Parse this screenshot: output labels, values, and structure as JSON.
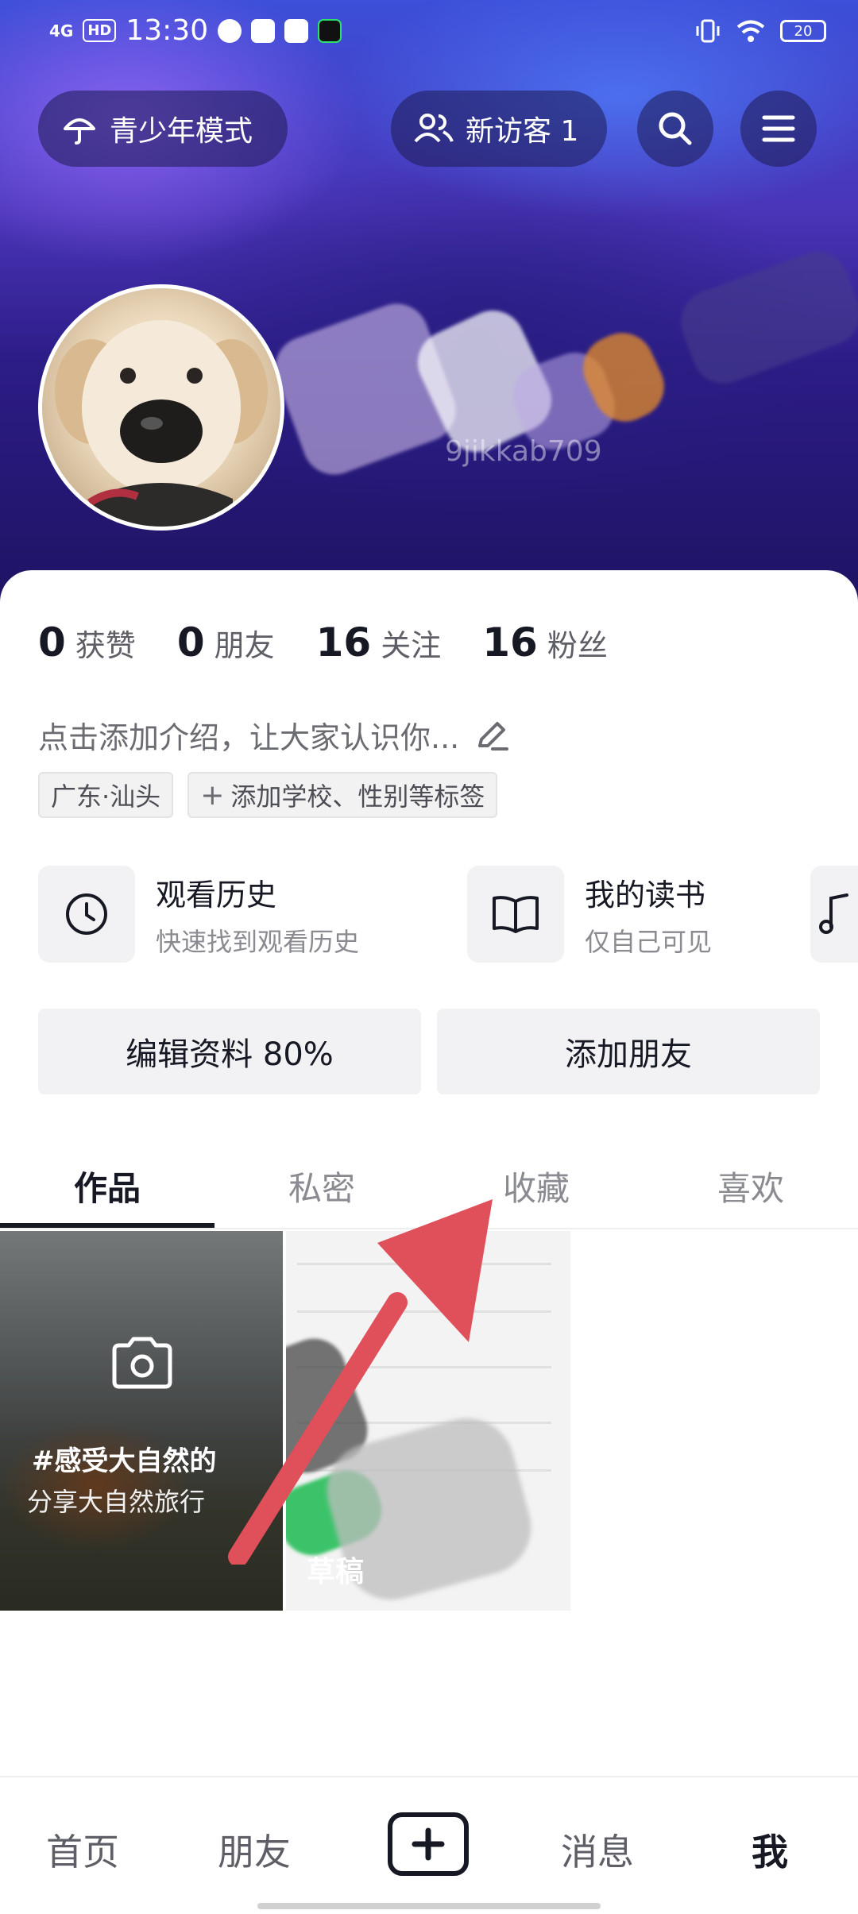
{
  "status_bar": {
    "network": "4G",
    "hd": "HD",
    "time": "13:30",
    "battery": "20"
  },
  "header": {
    "youth_mode_label": "青少年模式",
    "new_visitors_label": "新访客 1",
    "username_partial": "9jikkab709"
  },
  "stats": [
    {
      "num": "0",
      "label": "获赞"
    },
    {
      "num": "0",
      "label": "朋友"
    },
    {
      "num": "16",
      "label": "关注"
    },
    {
      "num": "16",
      "label": "粉丝"
    }
  ],
  "bio": "点击添加介绍，让大家认识你...",
  "tags": {
    "location": "广东·汕头",
    "add": "添加学校、性别等标签"
  },
  "shortcuts": [
    {
      "title": "观看历史",
      "subtitle": "快速找到观看历史",
      "icon": "clock-icon"
    },
    {
      "title": "我的读书",
      "subtitle": "仅自己可见",
      "icon": "book-icon"
    }
  ],
  "actions": {
    "edit_profile": "编辑资料 80%",
    "add_friends": "添加朋友"
  },
  "tabs": [
    "作品",
    "私密",
    "收藏",
    "喜欢"
  ],
  "works": {
    "tile1_title": "#感受大自然的",
    "tile1_subtitle": "分享大自然旅行",
    "tile2_label": "草稿"
  },
  "bottom_nav": {
    "home": "首页",
    "friends": "朋友",
    "messages": "消息",
    "me": "我"
  },
  "colors": {
    "accent_arrow": "#e0505a",
    "text_primary": "#161823"
  }
}
